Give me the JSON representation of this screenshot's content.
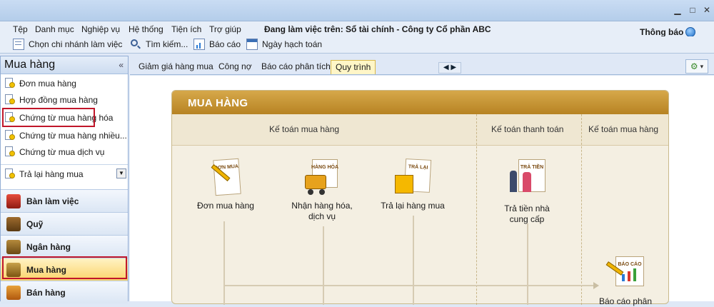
{
  "window": {
    "minimize_glyph": "▁",
    "maximize_glyph": "□",
    "close_glyph": "✕"
  },
  "menubar": {
    "items": [
      "Tệp",
      "Danh mục",
      "Nghiệp vụ",
      "Hệ thống",
      "Tiện ích",
      "Trợ giúp"
    ],
    "working_on": "Đang làm việc trên: Sổ tài chính - Công ty Cổ phần ABC",
    "notify_label": "Thông báo"
  },
  "toolbar": {
    "branch_label": "Chọn chi nhánh làm việc",
    "search_label": "Tìm kiếm...",
    "report_label": "Báo cáo",
    "posting_date_label": "Ngày hạch toán"
  },
  "leftpane": {
    "title": "Mua hàng",
    "collapse_glyph": "«",
    "items": [
      "Đơn mua hàng",
      "Hợp đồng mua hàng",
      "Chứng từ mua hàng hóa",
      "Chứng từ mua  hàng nhiều...",
      "Chứng từ mua dịch vụ"
    ],
    "dropdown_item": "Trả lại hàng mua",
    "dropdown_glyph": "▼",
    "modules": [
      "Bàn làm việc",
      "Quỹ",
      "Ngân hàng",
      "Mua hàng",
      "Bán hàng"
    ],
    "active_module": "Mua hàng"
  },
  "tabs": {
    "items": [
      "Giảm giá hàng mua",
      "Công nợ",
      "Báo cáo phân tích",
      "Quy trình"
    ],
    "active": "Quy trình",
    "arrows": "◀ ▶",
    "gear_glyph": "⚙",
    "gear_arrow": "▾"
  },
  "flow": {
    "title": "MUA HÀNG",
    "lanes": [
      "Kế toán mua hàng",
      "Kế toán thanh toán",
      "Kế toán mua hàng"
    ],
    "nodes": {
      "order": {
        "label": "Đơn mua hàng",
        "tag": "ĐƠN MUA"
      },
      "receive": {
        "label_line1": "Nhận hàng hóa,",
        "label_line2": "dịch vụ",
        "tag": "HÀNG HÓA"
      },
      "return": {
        "label": "Trả lại hàng mua",
        "tag": "TRẢ LẠI"
      },
      "pay": {
        "label_line1": "Trả tiền nhà",
        "label_line2": "cung cấp",
        "tag": "TRẢ TIỀN"
      },
      "report": {
        "label": "Báo cáo phân",
        "tag": "BÁO CÁO"
      }
    }
  },
  "colors": {
    "accent": "#c0162a",
    "header_gold": "#c89436",
    "active_module": "#fbd46a"
  }
}
